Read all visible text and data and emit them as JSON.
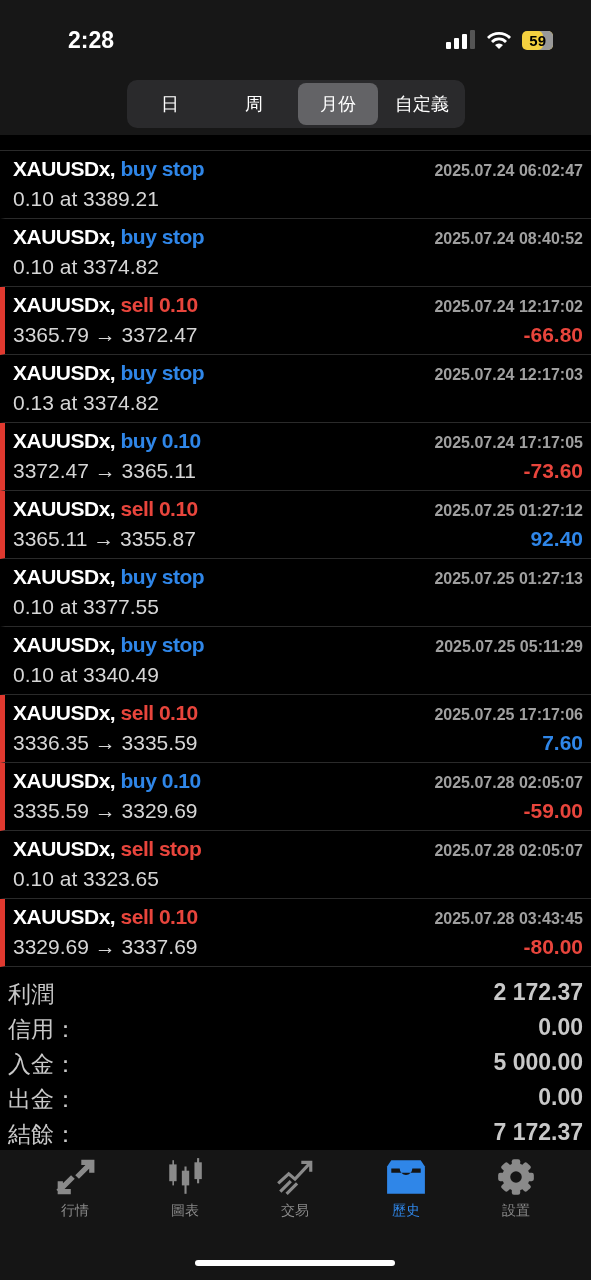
{
  "status_bar": {
    "time": "2:28",
    "battery": "59"
  },
  "period_tabs": [
    {
      "label": "日",
      "selected": false
    },
    {
      "label": "周",
      "selected": false
    },
    {
      "label": "月份",
      "selected": true
    },
    {
      "label": "自定義",
      "selected": false
    }
  ],
  "history": [
    {
      "kind": "order",
      "symbol": "XAUUSDx,",
      "sell": false,
      "action": "buy stop",
      "time": "2025.07.24 06:02:47",
      "detail": "0.10 at 3389.21"
    },
    {
      "kind": "order",
      "symbol": "XAUUSDx,",
      "sell": false,
      "action": "buy stop",
      "time": "2025.07.24 08:40:52",
      "detail": "0.10 at 3374.82"
    },
    {
      "kind": "deal",
      "symbol": "XAUUSDx,",
      "sell": true,
      "action": "sell 0.10",
      "time": "2025.07.24 12:17:02",
      "detail": "3365.79 → 3372.47",
      "profit": "-66.80",
      "loss": true
    },
    {
      "kind": "order",
      "symbol": "XAUUSDx,",
      "sell": false,
      "action": "buy stop",
      "time": "2025.07.24 12:17:03",
      "detail": "0.13 at 3374.82"
    },
    {
      "kind": "deal",
      "symbol": "XAUUSDx,",
      "sell": false,
      "action": "buy 0.10",
      "time": "2025.07.24 17:17:05",
      "detail": "3372.47 → 3365.11",
      "profit": "-73.60",
      "loss": true
    },
    {
      "kind": "deal",
      "symbol": "XAUUSDx,",
      "sell": true,
      "action": "sell 0.10",
      "time": "2025.07.25 01:27:12",
      "detail": "3365.11 → 3355.87",
      "profit": "92.40",
      "loss": false
    },
    {
      "kind": "order",
      "symbol": "XAUUSDx,",
      "sell": false,
      "action": "buy stop",
      "time": "2025.07.25 01:27:13",
      "detail": "0.10 at 3377.55"
    },
    {
      "kind": "order",
      "symbol": "XAUUSDx,",
      "sell": false,
      "action": "buy stop",
      "time": "2025.07.25 05:11:29",
      "detail": "0.10 at 3340.49"
    },
    {
      "kind": "deal",
      "symbol": "XAUUSDx,",
      "sell": true,
      "action": "sell 0.10",
      "time": "2025.07.25 17:17:06",
      "detail": "3336.35 → 3335.59",
      "profit": "7.60",
      "loss": false
    },
    {
      "kind": "deal",
      "symbol": "XAUUSDx,",
      "sell": false,
      "action": "buy 0.10",
      "time": "2025.07.28 02:05:07",
      "detail": "3335.59 → 3329.69",
      "profit": "-59.00",
      "loss": true
    },
    {
      "kind": "order",
      "symbol": "XAUUSDx,",
      "sell": true,
      "action": "sell stop",
      "time": "2025.07.28 02:05:07",
      "detail": "0.10 at 3323.65"
    },
    {
      "kind": "deal",
      "symbol": "XAUUSDx,",
      "sell": true,
      "action": "sell 0.10",
      "time": "2025.07.28 03:43:45",
      "detail": "3329.69 → 3337.69",
      "profit": "-80.00",
      "loss": true
    }
  ],
  "summary": [
    {
      "label": "利潤",
      "value": "2 172.37"
    },
    {
      "label": "信用：",
      "value": "0.00"
    },
    {
      "label": "入金：",
      "value": "5 000.00"
    },
    {
      "label": "出金：",
      "value": "0.00"
    },
    {
      "label": "結餘：",
      "value": "7 172.37"
    }
  ],
  "bottom_nav": [
    {
      "label": "行情",
      "selected": false
    },
    {
      "label": "圖表",
      "selected": false
    },
    {
      "label": "交易",
      "selected": false
    },
    {
      "label": "歷史",
      "selected": true
    },
    {
      "label": "設置",
      "selected": false
    }
  ]
}
